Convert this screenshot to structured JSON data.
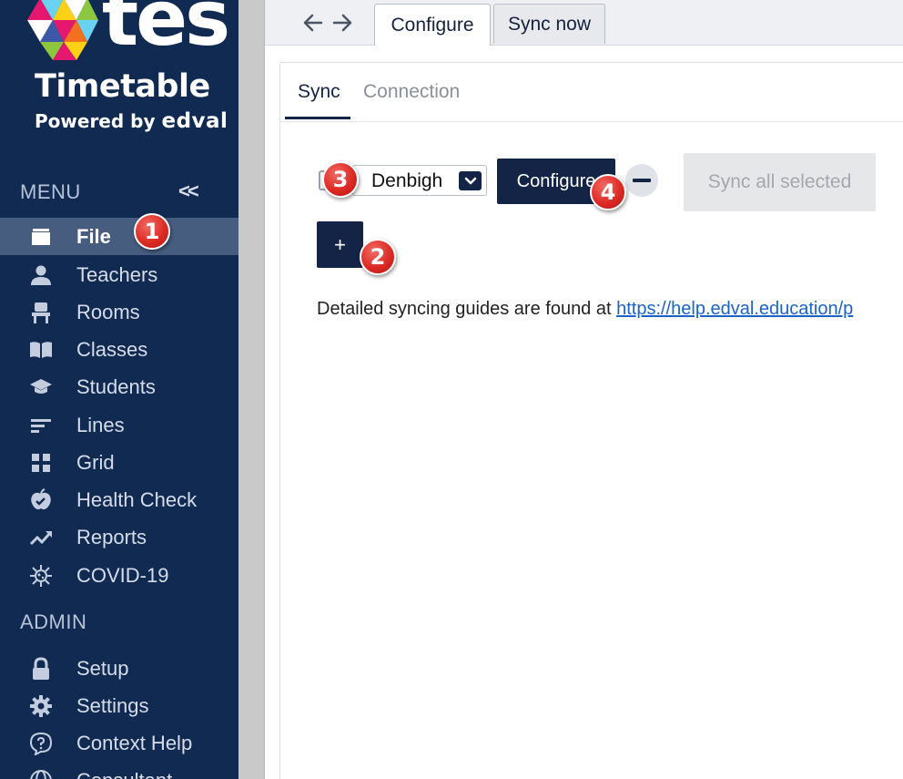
{
  "app": {
    "logo_text": "tes",
    "product": "Timetable",
    "powered_by": "Powered by",
    "brand": "edval"
  },
  "sidebar": {
    "menu_title": "MENU",
    "collapse_label": "<<",
    "admin_title": "ADMIN",
    "menu_items": [
      {
        "label": "File",
        "icon": "folder-icon",
        "active": true
      },
      {
        "label": "Teachers",
        "icon": "person-icon"
      },
      {
        "label": "Rooms",
        "icon": "chair-icon"
      },
      {
        "label": "Classes",
        "icon": "book-icon"
      },
      {
        "label": "Students",
        "icon": "graduation-cap-icon"
      },
      {
        "label": "Lines",
        "icon": "lines-icon"
      },
      {
        "label": "Grid",
        "icon": "grid-icon"
      },
      {
        "label": "Health Check",
        "icon": "apple-check-icon"
      },
      {
        "label": "Reports",
        "icon": "trend-icon"
      },
      {
        "label": "COVID-19",
        "icon": "virus-icon"
      }
    ],
    "admin_items": [
      {
        "label": "Setup",
        "icon": "lock-icon"
      },
      {
        "label": "Settings",
        "icon": "gear-icon"
      },
      {
        "label": "Context Help",
        "icon": "help-icon"
      },
      {
        "label": "Consultant",
        "icon": "globe-icon"
      }
    ]
  },
  "topbar": {
    "tabs": [
      {
        "label": "Configure",
        "active": true
      },
      {
        "label": "Sync now",
        "active": false
      }
    ]
  },
  "main": {
    "inner_tabs": [
      {
        "label": "Sync",
        "active": true
      },
      {
        "label": "Connection",
        "active": false
      }
    ],
    "row": {
      "selected_value": "Denbigh",
      "configure_label": "Configure",
      "remove_label": "−"
    },
    "sync_all_label": "Sync all selected",
    "add_label": "+",
    "guide_text": "Detailed syncing guides are found at ",
    "guide_link": "https://help.edval.education/p"
  },
  "callouts": [
    "1",
    "2",
    "3",
    "4"
  ],
  "colors": {
    "sidebar_bg": "#112a52",
    "active_item_bg": "#475d80",
    "primary": "#142446",
    "badge_red": "#dd2b25",
    "link": "#1b63c6"
  }
}
